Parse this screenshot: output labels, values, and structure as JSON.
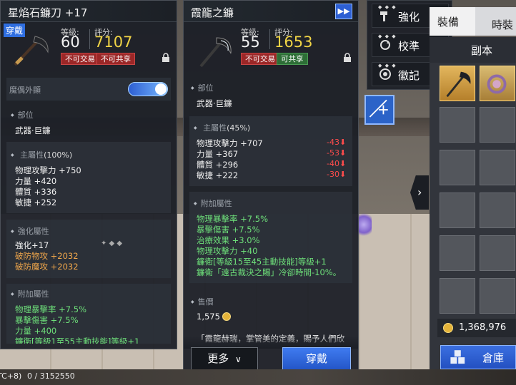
{
  "footer": {
    "tag": "TC+8)",
    "ratio": "0 / 3152550"
  },
  "left_panel": {
    "title": "星焰石鐮刀 +17",
    "badge": "穿戴",
    "level_label": "等級:",
    "level": "60",
    "score_label": "評分:",
    "score": "7107",
    "tags": [
      "不可交易",
      "不可共享"
    ],
    "appearance_label": "魔偶外顯",
    "part_head": "部位",
    "part_value": "武器·巨鐮",
    "main_attr_head": "主屬性",
    "main_attr_pct": "(100%)",
    "main_attrs": [
      "物理攻擊力 +750",
      "力量 +420",
      "體質 +336",
      "敏捷 +252"
    ],
    "enhance_head": "強化屬性",
    "enhance_level": "強化+17",
    "enhance_attrs": [
      "破防物攻 +2032",
      "破防魔攻 +2032"
    ],
    "extra_head": "附加屬性",
    "extra_attrs": [
      "物理暴擊率 +7.5%",
      "暴擊傷害 +7.5%",
      "力量 +400",
      "鐮衛[等級1至55主動技能]等級+1"
    ]
  },
  "middle_panel": {
    "title": "霞龍之鐮",
    "level_label": "等級:",
    "level": "55",
    "score_label": "評分:",
    "score": "1653",
    "tags": [
      "不可交易",
      "可共享"
    ],
    "part_head": "部位",
    "part_value": "武器·巨鐮",
    "main_attr_head": "主屬性",
    "main_attr_pct": "(45%)",
    "main_attrs": [
      "物理攻擊力 +707",
      "力量 +367",
      "體質 +296",
      "敏捷 +222"
    ],
    "main_diffs": [
      "-43",
      "-53",
      "-40",
      "-30"
    ],
    "extra_head": "附加屬性",
    "extra_attrs": [
      "物理暴擊率 +7.5%",
      "暴擊傷害 +7.5%",
      "治療效果 +3.0%",
      "物理攻擊力 +40",
      "鐮衛[等級15至45主動技能]等級+1"
    ],
    "extra_special": "鐮衛「遠古裁決之賜」冷卻時間-10%。",
    "price_head": "售價",
    "price": "1,575",
    "description": "「霞龍赫瑞，掌管美的定義，賜予人們欣",
    "more_button": "更多",
    "equip_button": "穿戴"
  },
  "menu": {
    "items": [
      "強化",
      "校準",
      "徽記"
    ]
  },
  "inventory": {
    "tabs": [
      "裝備",
      "時裝"
    ],
    "sub_header": "副本",
    "currency": "1,368,976",
    "warehouse_button": "倉庫"
  }
}
